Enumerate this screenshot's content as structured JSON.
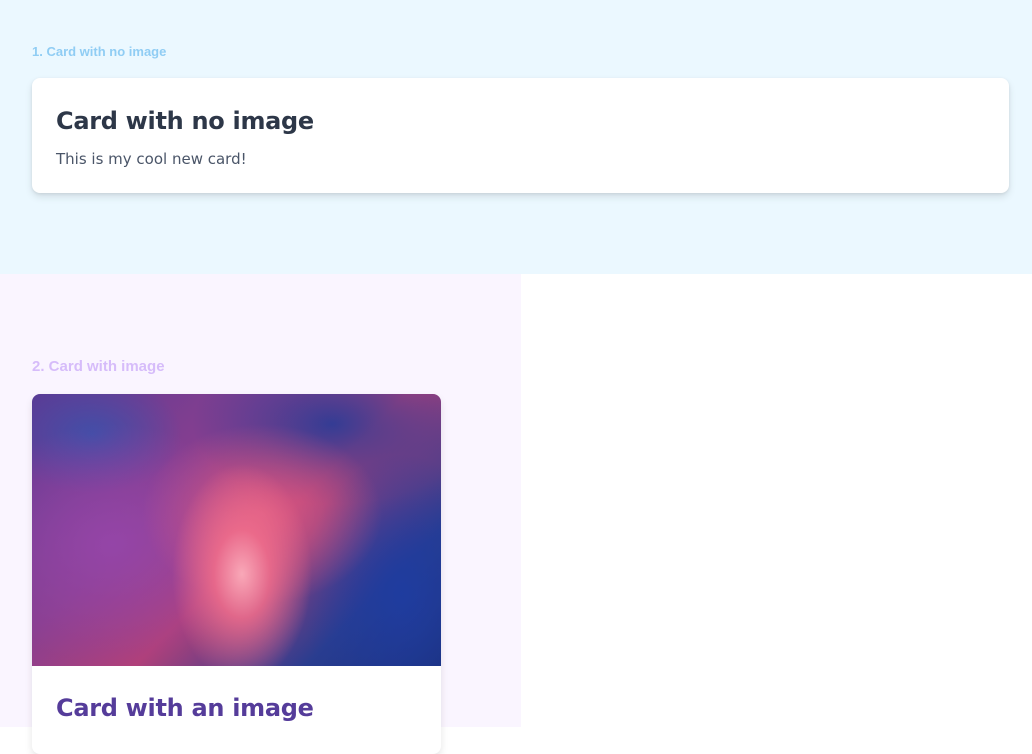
{
  "section1": {
    "label": "1. Card with no image",
    "card": {
      "title": "Card with no image",
      "body": "This is my cool new card!"
    }
  },
  "section2": {
    "label": "2. Card with image",
    "card": {
      "title": "Card with an image"
    }
  },
  "colors": {
    "section1_bg": "#ebf8ff",
    "section1_label": "#90cdf4",
    "section2_bg": "#faf5ff",
    "section2_label": "#d6bcfa",
    "card_title_dark": "#2d3748",
    "card_title_purple": "#553c9a"
  }
}
